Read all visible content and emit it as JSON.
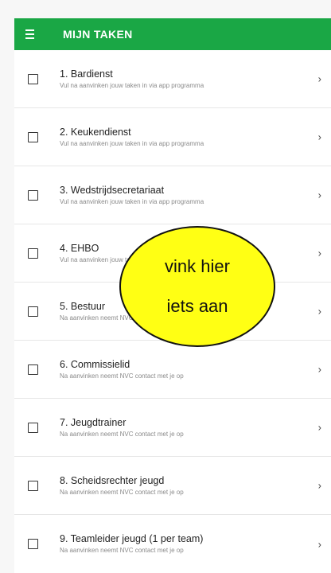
{
  "header": {
    "title": "MIJN TAKEN",
    "menu_icon": "hamburger-menu-icon",
    "background": "#1aa745"
  },
  "tasks": [
    {
      "title": "1. Bardienst",
      "subtitle": "Vul na aanvinken jouw taken in via app programma",
      "checked": false
    },
    {
      "title": "2. Keukendienst",
      "subtitle": "Vul na aanvinken jouw taken in via app programma",
      "checked": false
    },
    {
      "title": "3. Wedstrijdsecretariaat",
      "subtitle": "Vul na aanvinken jouw taken in via app programma",
      "checked": false
    },
    {
      "title": "4. EHBO",
      "subtitle": "Vul na aanvinken jouw taken in via app programma",
      "checked": false
    },
    {
      "title": "5. Bestuur",
      "subtitle": "Na aanvinken neemt NVC contact met je op",
      "checked": false
    },
    {
      "title": "6. Commissielid",
      "subtitle": "Na aanvinken neemt NVC contact met je op",
      "checked": false
    },
    {
      "title": "7. Jeugdtrainer",
      "subtitle": "Na aanvinken neemt NVC contact met je op",
      "checked": false
    },
    {
      "title": "8. Scheidsrechter jeugd",
      "subtitle": "Na aanvinken neemt NVC contact met je op",
      "checked": false
    },
    {
      "title": "9. Teamleider jeugd (1 per team)",
      "subtitle": "Na aanvinken neemt NVC contact met je op",
      "checked": false
    }
  ],
  "chevron_icon": "chevron-right-icon",
  "callout": {
    "line1": "vink hier",
    "line2": "iets aan",
    "color": "#ffff14"
  }
}
